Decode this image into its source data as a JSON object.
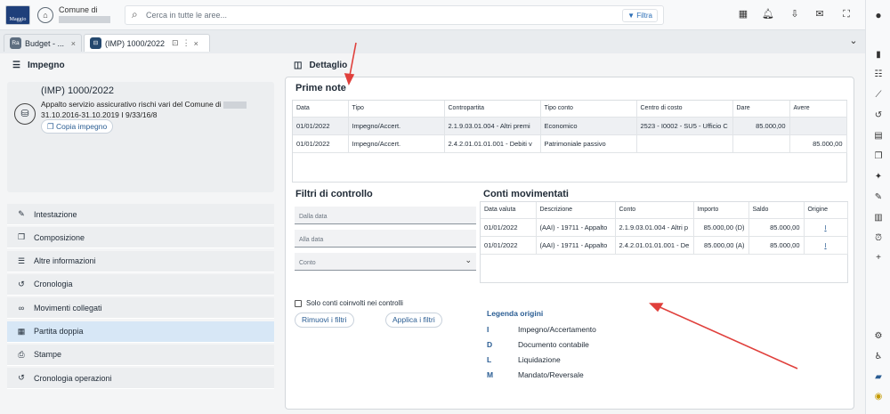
{
  "topbar": {
    "logo_text": "Maggio",
    "comune_label": "Comune di",
    "search_placeholder": "Cerca in tutte le aree...",
    "filter_label": "Filtra",
    "icon_names": [
      "dashboard-icon",
      "bell-icon",
      "download-icon",
      "mail-icon",
      "fullscreen-icon",
      "account-icon"
    ]
  },
  "tabs": [
    {
      "badge": "Ra",
      "label": "Budget - ...",
      "close": "×"
    },
    {
      "badge": "⊟",
      "label": "(IMP) 1000/2022",
      "pin": "⊡",
      "more": "⋮",
      "close": "×"
    }
  ],
  "left": {
    "header": "Impegno",
    "card": {
      "title": "(IMP) 1000/2022",
      "line1": "Appalto servizio assicurativo rischi vari del Comune di",
      "line2": "31.10.2016-31.10.2019 I 9/33/16/8",
      "copy_button": "Copia impegno"
    },
    "menu": [
      {
        "label": "Intestazione",
        "icon": "pencil-icon",
        "glyph": "✎"
      },
      {
        "label": "Composizione",
        "icon": "layers-icon",
        "glyph": "❐"
      },
      {
        "label": "Altre informazioni",
        "icon": "list-icon",
        "glyph": "☰"
      },
      {
        "label": "Cronologia",
        "icon": "history-icon",
        "glyph": "↺"
      },
      {
        "label": "Movimenti collegati",
        "icon": "link-icon",
        "glyph": "∞"
      },
      {
        "label": "Partita doppia",
        "icon": "grid-icon",
        "glyph": "▦",
        "selected": true
      },
      {
        "label": "Stampe",
        "icon": "print-icon",
        "glyph": "⎙"
      },
      {
        "label": "Cronologia operazioni",
        "icon": "history-icon",
        "glyph": "↺"
      }
    ]
  },
  "right": {
    "header": "Dettaglio",
    "prime_note": {
      "title": "Prime note",
      "columns": [
        "Data",
        "Tipo",
        "Contropartita",
        "Tipo conto",
        "Centro di costo",
        "Dare",
        "Avere"
      ],
      "rows": [
        [
          "01/01/2022",
          "Impegno/Accert.",
          "2.1.9.03.01.004 - Altri premi",
          "Economico",
          "2523 - I0002 - SU5 - Ufficio C",
          "85.000,00",
          ""
        ],
        [
          "01/01/2022",
          "Impegno/Accert.",
          "2.4.2.01.01.01.001 - Debiti v",
          "Patrimoniale passivo",
          "",
          "",
          "85.000,00"
        ]
      ]
    },
    "filtri": {
      "title": "Filtri di controllo",
      "dalla_data": "Dalla data",
      "alla_data": "Alla data",
      "conto": "Conto",
      "checkbox": "Solo conti coinvolti nei controlli",
      "rimuovi": "Rimuovi i filtri",
      "applica": "Applica i filtri"
    },
    "conti": {
      "title": "Conti movimentati",
      "columns": [
        "Data valuta",
        "Descrizione",
        "Conto",
        "Importo",
        "Saldo",
        "Origine"
      ],
      "rows": [
        [
          "01/01/2022",
          "(AAI) - 19711 - Appalto",
          "2.1.9.03.01.004 - Altri p",
          "85.000,00 (D)",
          "85.000,00",
          "I"
        ],
        [
          "01/01/2022",
          "(AAI) - 19711 - Appalto",
          "2.4.2.01.01.01.001 - De",
          "85.000,00 (A)",
          "85.000,00",
          "I"
        ]
      ]
    },
    "legenda": {
      "title": "Legenda origini",
      "items": [
        {
          "key": "I",
          "label": "Impegno/Accertamento"
        },
        {
          "key": "D",
          "label": "Documento contabile"
        },
        {
          "key": "L",
          "label": "Liquidazione"
        },
        {
          "key": "M",
          "label": "Mandato/Reversale"
        }
      ]
    }
  },
  "rail_icons": [
    "bookmark-icon",
    "list-icon",
    "trend-icon",
    "history-icon",
    "note-icon",
    "copy-icon",
    "pin-icon",
    "edit-icon",
    "file-icon",
    "alarm-icon",
    "plus-icon",
    "settings-icon",
    "accessibility-icon",
    "chat-icon",
    "help-icon"
  ],
  "colors": {
    "accent": "#2a5d93",
    "selected_menu": "#d7e7f6",
    "annotation_arrow": "#e0403c"
  }
}
